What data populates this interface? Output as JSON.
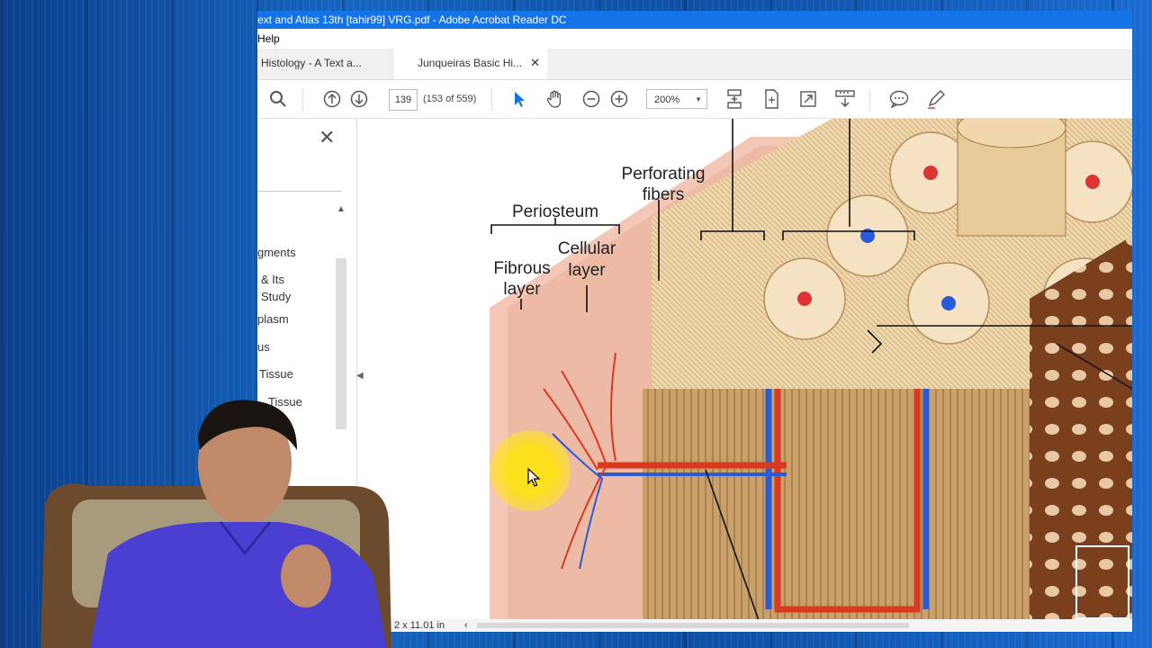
{
  "app": {
    "title": "ext and Atlas 13th [tahir99] VRG.pdf - Adobe Acrobat Reader DC",
    "menu_help": "Help"
  },
  "tabs": [
    {
      "label": "Histology - A Text a...",
      "active": false
    },
    {
      "label": "Junqueiras Basic Hi...",
      "active": true
    }
  ],
  "toolbar": {
    "page_number": "139",
    "page_count": "(153 of 559)",
    "zoom": "200%",
    "icons": [
      "search-icon",
      "page-up-icon",
      "page-down-icon",
      "select-cursor-icon",
      "hand-icon",
      "zoom-out-icon",
      "zoom-in-icon",
      "zoom-caret-icon",
      "scrolling-mode-icon",
      "fit-page-icon",
      "fullscreen-icon",
      "read-mode-icon",
      "comment-icon",
      "pen-icon"
    ]
  },
  "nav_pane": {
    "items": [
      "gments",
      "& Its",
      "Study",
      "plasm",
      "us",
      "Tissue",
      "Tissue"
    ]
  },
  "figure": {
    "labels": {
      "perforating": "Perforating",
      "fibers": "fibers",
      "periosteum": "Periosteum",
      "cellular": "Cellular",
      "layer_cellular": "layer",
      "fibrous": "Fibrous",
      "layer_fibrous": "layer"
    }
  },
  "status": {
    "page_size": "2 x 11.01 in"
  },
  "colors": {
    "title_bar": "#1473e6",
    "background": "#0d4fa3",
    "accent": "#1473e6",
    "highlight": "#ffe014"
  }
}
